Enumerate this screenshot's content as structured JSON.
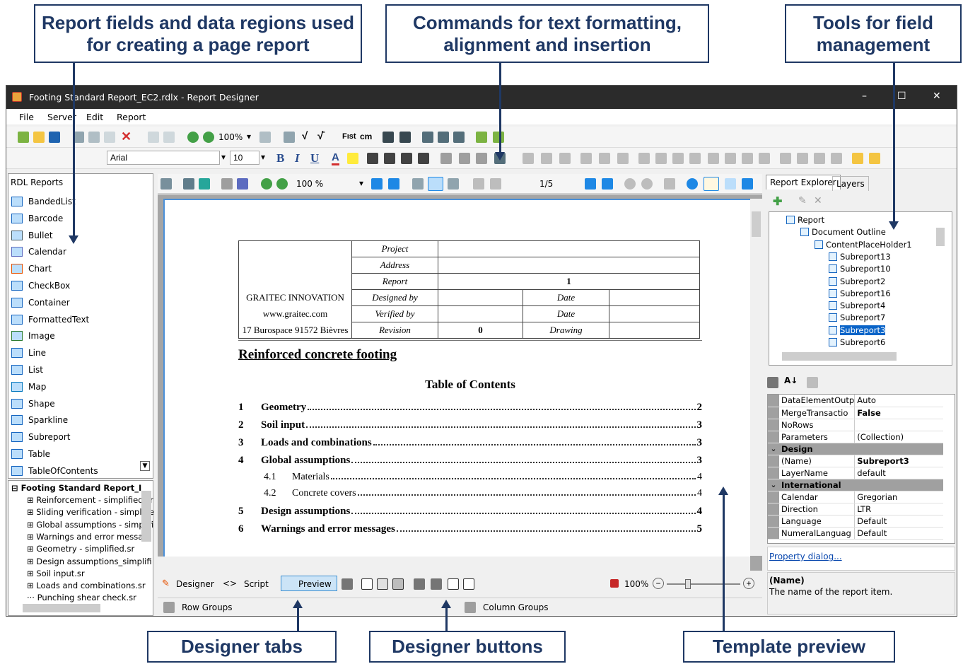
{
  "callouts": {
    "report_fields": "Report fields and data regions used for creating a page report",
    "commands": "Commands for text formatting, alignment and insertion",
    "field_tools": "Tools for field management",
    "designer_tabs": "Designer tabs",
    "designer_buttons": "Designer buttons",
    "template_preview": "Template preview"
  },
  "window": {
    "title": "Footing Standard Report_EC2.rdlx - Report Designer",
    "minimize": "–",
    "maximize": "☐",
    "close": "✕"
  },
  "menu": [
    "File",
    "Server",
    "Edit",
    "Report"
  ],
  "toolbar": {
    "zoom": "100%",
    "formula1": "√",
    "formula2": "√̄",
    "first_label": "Fıst",
    "cm_label": "cm",
    "font_name": "Arial",
    "font_size": "10",
    "bold": "B",
    "italic": "I",
    "underline": "U",
    "color_a": "A"
  },
  "toolbox": {
    "header": "RDL Reports",
    "items": [
      "BandedList",
      "Barcode",
      "Bullet",
      "Calendar",
      "Chart",
      "CheckBox",
      "Container",
      "FormattedText",
      "Image",
      "Line",
      "List",
      "Map",
      "Shape",
      "Sparkline",
      "Subreport",
      "Table",
      "TableOfContents"
    ]
  },
  "project_tree": {
    "root": "Footing Standard Report_I",
    "items": [
      "Reinforcement - simplified.sr",
      "Sliding verification - simplifie",
      "Global assumptions - simplifi",
      "Warnings and error messag",
      "Geometry - simplified.sr",
      "Design assumptions_simplifi",
      "Soil input.sr",
      "Loads and combinations.sr",
      "Punching shear check.sr"
    ]
  },
  "preview_toolbar": {
    "zoom": "100 %",
    "page": "1/5"
  },
  "report": {
    "company": "GRAITEC INNOVATION",
    "website": "www.graitec.com",
    "address": "17 Burospace 91572 Bièvres",
    "labels": {
      "project": "Project",
      "address": "Address",
      "report": "Report",
      "designed_by": "Designed by",
      "verified_by": "Verified by",
      "revision": "Revision",
      "date1": "Date",
      "date2": "Date",
      "drawing": "Drawing"
    },
    "report_value": "1",
    "revision_value": "0",
    "title": "Reinforced concrete footing",
    "toc_title": "Table of Contents",
    "toc": [
      {
        "num": "1",
        "text": "Geometry",
        "page": "2",
        "bold": true
      },
      {
        "num": "2",
        "text": "Soil input",
        "page": "3",
        "bold": true
      },
      {
        "num": "3",
        "text": "Loads and combinations",
        "page": "3",
        "bold": true
      },
      {
        "num": "4",
        "text": "Global assumptions",
        "page": "3",
        "bold": true
      },
      {
        "num": "4.1",
        "text": "Materials",
        "page": "4",
        "bold": false
      },
      {
        "num": "4.2",
        "text": "Concrete covers",
        "page": "4",
        "bold": false
      },
      {
        "num": "5",
        "text": "Design assumptions",
        "page": "4",
        "bold": true
      },
      {
        "num": "6",
        "text": "Warnings and error messages",
        "page": "5",
        "bold": true
      }
    ]
  },
  "designer_tabs": {
    "designer": "Designer",
    "script": "Script",
    "preview": "Preview",
    "zoom": "100%"
  },
  "groups": {
    "row": "Row Groups",
    "column": "Column Groups"
  },
  "explorer": {
    "tab1": "Report Explorer",
    "tab2": "Layers",
    "tree": [
      "Report",
      "Document Outline",
      "ContentPlaceHolder1",
      "Subreport13",
      "Subreport10",
      "Subreport2",
      "Subreport16",
      "Subreport4",
      "Subreport7",
      "Subreport3",
      "Subreport6"
    ]
  },
  "properties": {
    "rows": [
      {
        "k": "DataElementOutp",
        "v": "Auto"
      },
      {
        "k": "MergeTransactio",
        "v": "False",
        "bold": true
      },
      {
        "k": "NoRows",
        "v": ""
      },
      {
        "k": "Parameters",
        "v": "(Collection)"
      },
      {
        "k": "Design",
        "v": "",
        "cat": true
      },
      {
        "k": "(Name)",
        "v": "Subreport3",
        "bold": true
      },
      {
        "k": "LayerName",
        "v": "default"
      },
      {
        "k": "International",
        "v": "",
        "cat": true
      },
      {
        "k": "Calendar",
        "v": "Gregorian"
      },
      {
        "k": "Direction",
        "v": "LTR"
      },
      {
        "k": "Language",
        "v": "Default"
      },
      {
        "k": "NumeralLanguag",
        "v": "Default"
      }
    ],
    "link": "Property dialog...",
    "desc_title": "(Name)",
    "desc_text": "The name of the report item."
  }
}
